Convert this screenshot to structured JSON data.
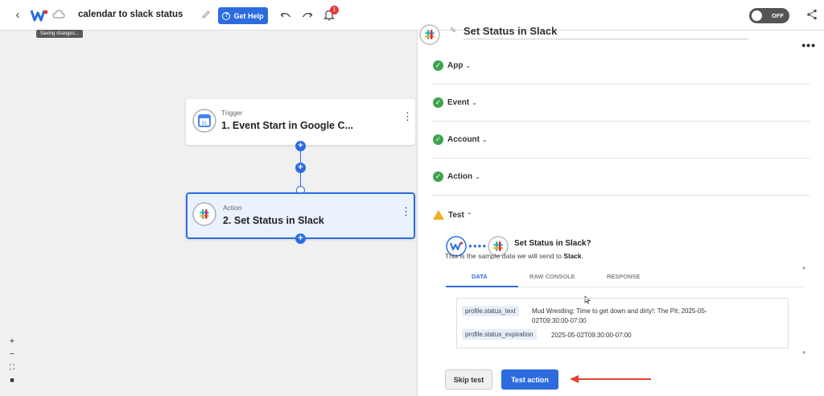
{
  "topbar": {
    "back_icon": "chevron-left-icon",
    "title": "calendar to slack status",
    "tooltip": "Saving changes...",
    "help_label": "Get Help",
    "notification_count": "1",
    "toggle_label": "OFF",
    "accent_color": "#2d6cdf"
  },
  "canvas": {
    "trigger": {
      "kind": "Trigger",
      "name": "1. Event Start in Google C..."
    },
    "action": {
      "kind": "Action",
      "name": "2. Set Status in Slack"
    }
  },
  "panel": {
    "title": "Set Status in Slack",
    "sections": [
      {
        "label": "App",
        "status": "complete"
      },
      {
        "label": "Event",
        "status": "complete"
      },
      {
        "label": "Account",
        "status": "complete"
      },
      {
        "label": "Action",
        "status": "complete"
      },
      {
        "label": "Test",
        "status": "warning"
      }
    ],
    "test": {
      "question": "Set Status in Slack?",
      "sample_prefix": "This is the sample data we will send to",
      "sample_target": "Slack",
      "tabs": [
        "DATA",
        "RAW CONSOLE",
        "RESPONSE"
      ],
      "active_tab": "DATA",
      "rows": [
        {
          "key": "profile.status_text",
          "value": "Mud Wrestling: Time to get down and dirty!: The Pit; 2025-05-02T09:30:00-07:00"
        },
        {
          "key": "profile.status_expiration",
          "value": "2025-05-02T09:30:00-07:00"
        }
      ]
    },
    "skip_label": "Skip test",
    "test_label": "Test action"
  }
}
